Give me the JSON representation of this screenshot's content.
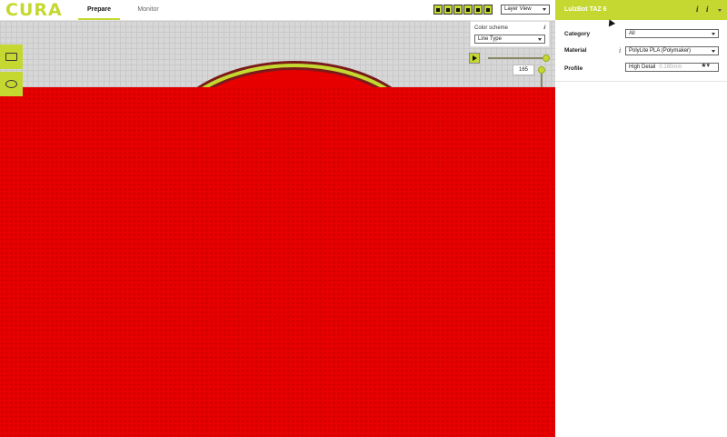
{
  "app": {
    "logo_text": "CURA",
    "logo_color": "#c5d832"
  },
  "header": {
    "tabs": [
      {
        "label": "Prepare",
        "active": true
      },
      {
        "label": "Monitor",
        "active": false
      }
    ],
    "view_mode_icons": [
      "solid-view-icon",
      "xray-view-icon",
      "layer-view-icon",
      "front-view-icon",
      "left-view-icon",
      "right-view-icon"
    ],
    "view_select": {
      "value": "Layer View"
    }
  },
  "left_toolbar": {
    "items": [
      "open-file-icon",
      "scale-icon"
    ]
  },
  "color_scheme": {
    "label": "Color scheme",
    "select_value": "Line Type"
  },
  "layer_slider": {
    "current_layer": "165",
    "level": 1.0
  },
  "sidebar": {
    "machine_name": "LulzBot TAZ 6",
    "rows": [
      {
        "label": "Category",
        "value": "All",
        "sub": ""
      },
      {
        "label": "Material",
        "value": "PolyLite PLA (Polymaker)",
        "sub": ""
      },
      {
        "label": "Profile",
        "value": "High Detail",
        "sub": "0.180mm"
      }
    ]
  },
  "colors": {
    "accent": "#c5d832",
    "model_red": "#e60000",
    "grid": "#d7d7d7"
  }
}
